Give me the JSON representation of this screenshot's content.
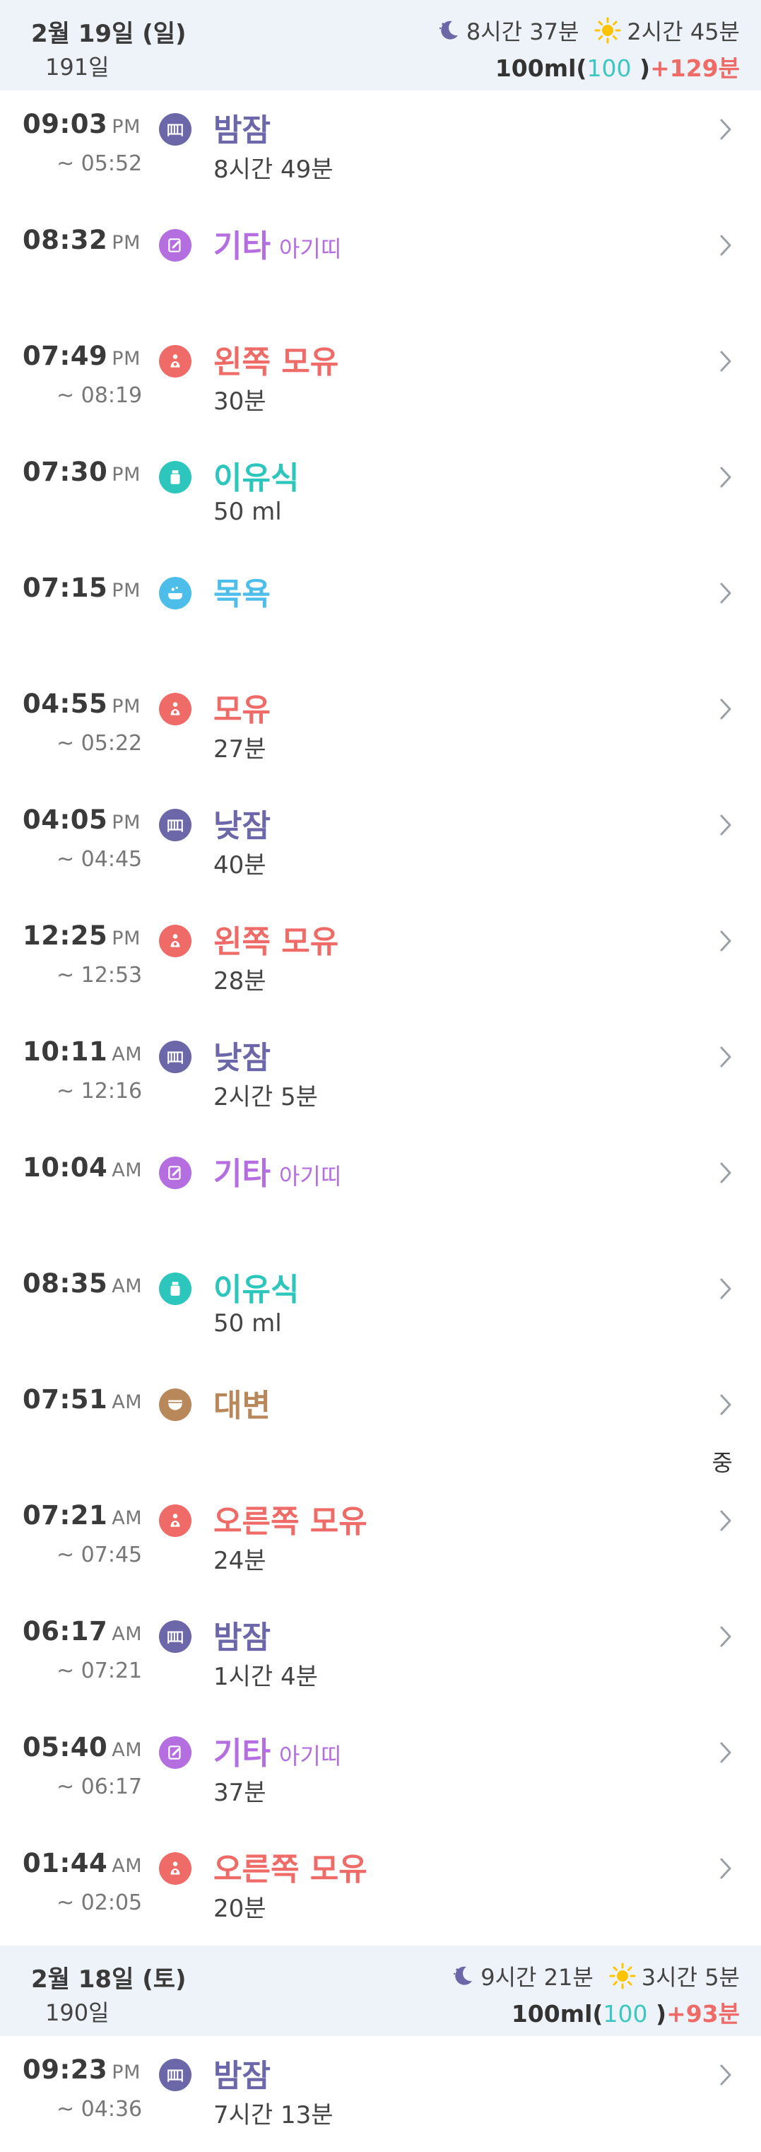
{
  "days": [
    {
      "date": "2월 19일 (일)",
      "age": "191일",
      "night_sleep": "8시간 37분",
      "day_sleep": "2시간 45분",
      "feed_prefix": "100ml(",
      "feed_teal": "100",
      "feed_suffix": " )",
      "feed_extra": "+129분",
      "entries": [
        {
          "time": "09:03",
          "ampm": "PM",
          "end": "~ 05:52",
          "icon": "crib-icon",
          "title": "밤잠",
          "note": "",
          "detail": "8시간 49분",
          "color": "#6b67a8"
        },
        {
          "time": "08:32",
          "ampm": "PM",
          "end": "",
          "icon": "memo-icon",
          "title": "기타",
          "note": "아기띠",
          "detail": "",
          "color": "#b46ee0"
        },
        {
          "time": "07:49",
          "ampm": "PM",
          "end": "~ 08:19",
          "icon": "breastfeed-icon",
          "title": "왼쪽 모유",
          "note": "",
          "detail": "30분",
          "color": "#ef6b67"
        },
        {
          "time": "07:30",
          "ampm": "PM",
          "end": "",
          "icon": "babyfood-icon",
          "title": "이유식",
          "note": "",
          "detail": "50 ml",
          "color": "#2cc6bd"
        },
        {
          "time": "07:15",
          "ampm": "PM",
          "end": "",
          "icon": "bath-icon",
          "title": "목욕",
          "note": "",
          "detail": "",
          "color": "#4dbdea"
        },
        {
          "time": "04:55",
          "ampm": "PM",
          "end": "~ 05:22",
          "icon": "breastfeed-icon",
          "title": "모유",
          "note": "",
          "detail": "27분",
          "color": "#ef6b67"
        },
        {
          "time": "04:05",
          "ampm": "PM",
          "end": "~ 04:45",
          "icon": "crib-icon",
          "title": "낮잠",
          "note": "",
          "detail": "40분",
          "color": "#6b67a8"
        },
        {
          "time": "12:25",
          "ampm": "PM",
          "end": "~ 12:53",
          "icon": "breastfeed-icon",
          "title": "왼쪽 모유",
          "note": "",
          "detail": "28분",
          "color": "#ef6b67"
        },
        {
          "time": "10:11",
          "ampm": "AM",
          "end": "~ 12:16",
          "icon": "crib-icon",
          "title": "낮잠",
          "note": "",
          "detail": "2시간 5분",
          "color": "#6b67a8"
        },
        {
          "time": "10:04",
          "ampm": "AM",
          "end": "",
          "icon": "memo-icon",
          "title": "기타",
          "note": "아기띠",
          "detail": "",
          "color": "#b46ee0"
        },
        {
          "time": "08:35",
          "ampm": "AM",
          "end": "",
          "icon": "babyfood-icon",
          "title": "이유식",
          "note": "",
          "detail": "50 ml",
          "color": "#2cc6bd"
        },
        {
          "time": "07:51",
          "ampm": "AM",
          "end": "",
          "icon": "diaper-icon",
          "title": "대변",
          "note": "",
          "detail": "",
          "color": "#b8875a",
          "flag": "중"
        },
        {
          "time": "07:21",
          "ampm": "AM",
          "end": "~ 07:45",
          "icon": "breastfeed-icon",
          "title": "오른쪽 모유",
          "note": "",
          "detail": "24분",
          "color": "#ef6b67"
        },
        {
          "time": "06:17",
          "ampm": "AM",
          "end": "~ 07:21",
          "icon": "crib-icon",
          "title": "밤잠",
          "note": "",
          "detail": "1시간 4분",
          "color": "#6b67a8"
        },
        {
          "time": "05:40",
          "ampm": "AM",
          "end": "~ 06:17",
          "icon": "memo-icon",
          "title": "기타",
          "note": "아기띠",
          "detail": "37분",
          "color": "#b46ee0"
        },
        {
          "time": "01:44",
          "ampm": "AM",
          "end": "~ 02:05",
          "icon": "breastfeed-icon",
          "title": "오른쪽 모유",
          "note": "",
          "detail": "20분",
          "color": "#ef6b67"
        }
      ]
    },
    {
      "date": "2월 18일 (토)",
      "age": "190일",
      "night_sleep": "9시간 21분",
      "day_sleep": "3시간 5분",
      "feed_prefix": "100ml(",
      "feed_teal": "100",
      "feed_suffix": " )",
      "feed_extra": "+93분",
      "entries": [
        {
          "time": "09:23",
          "ampm": "PM",
          "end": "~ 04:36",
          "icon": "crib-icon",
          "title": "밤잠",
          "note": "",
          "detail": "7시간 13분",
          "color": "#6b67a8"
        }
      ]
    }
  ]
}
